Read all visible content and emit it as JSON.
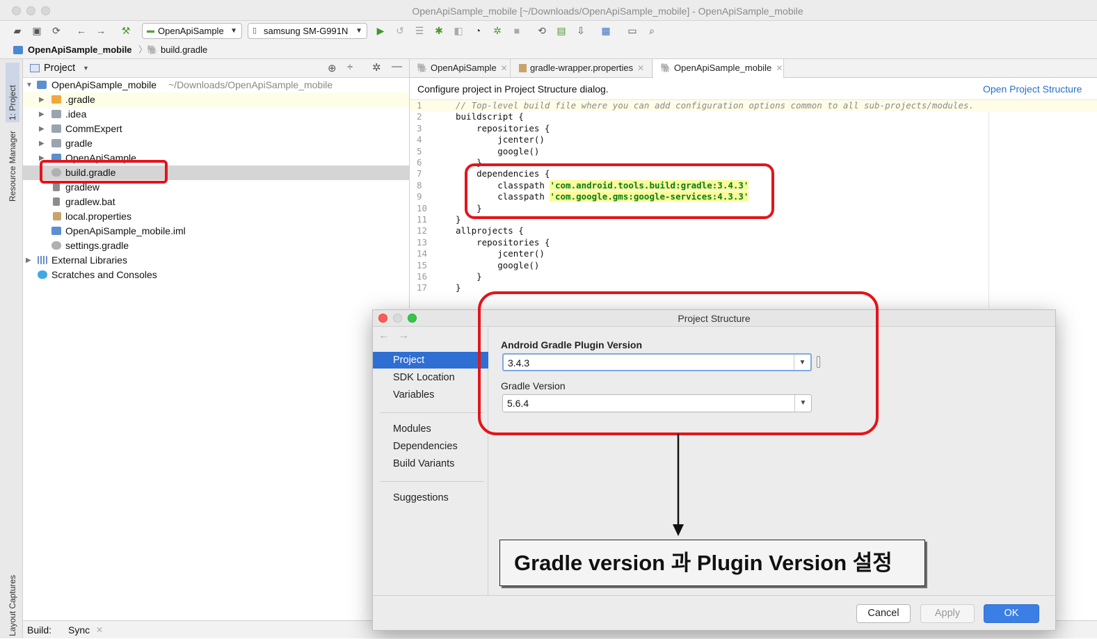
{
  "window": {
    "title": "OpenApiSample_mobile [~/Downloads/OpenApiSample_mobile] - OpenApiSample_mobile"
  },
  "toolbar": {
    "config_combo": "OpenApiSample",
    "device_combo": "samsung SM-G991N"
  },
  "breadcrumb": {
    "project": "OpenApiSample_mobile",
    "file": "build.gradle"
  },
  "side_strip": {
    "project_tab": "1: Project",
    "resource_manager": "Resource Manager",
    "layout_captures": "Layout Captures"
  },
  "project_panel": {
    "header": "Project",
    "tree": [
      {
        "label": "OpenApiSample_mobile",
        "path": "~/Downloads/OpenApiSample_mobile"
      },
      {
        "label": ".gradle"
      },
      {
        "label": ".idea"
      },
      {
        "label": "CommExpert"
      },
      {
        "label": "gradle"
      },
      {
        "label": "OpenApiSample"
      },
      {
        "label": "build.gradle"
      },
      {
        "label": "gradlew"
      },
      {
        "label": "gradlew.bat"
      },
      {
        "label": "local.properties"
      },
      {
        "label": "OpenApiSample_mobile.iml"
      },
      {
        "label": "settings.gradle"
      },
      {
        "label": "External Libraries"
      },
      {
        "label": "Scratches and Consoles"
      }
    ]
  },
  "bottom_bar": {
    "build_label": "Build:",
    "sync_tab": "Sync"
  },
  "editor": {
    "tabs": [
      {
        "label": "OpenApiSample"
      },
      {
        "label": "gradle-wrapper.properties"
      },
      {
        "label": "OpenApiSample_mobile"
      }
    ],
    "notice": "Configure project in Project Structure dialog.",
    "notice_link": "Open Project Structure",
    "lines": [
      "// Top-level build file where you can add configuration options common to all sub-projects/modules.",
      "buildscript {",
      "    repositories {",
      "        jcenter()",
      "        google()",
      "    }",
      "    dependencies {",
      "        classpath ",
      "        classpath ",
      "    }",
      "}",
      "allprojects {",
      "    repositories {",
      "        jcenter()",
      "        google()",
      "    }",
      "}"
    ],
    "strings": {
      "line8": "'com.android.tools.build:gradle:3.4.3'",
      "line9": "'com.google.gms:google-services:4.3.3'"
    },
    "line_numbers": [
      "1",
      "2",
      "3",
      "4",
      "5",
      "6",
      "7",
      "8",
      "9",
      "10",
      "11",
      "12",
      "13",
      "14",
      "15",
      "16",
      "17"
    ]
  },
  "dialog": {
    "title": "Project Structure",
    "nav": {
      "project": "Project",
      "sdk_location": "SDK Location",
      "variables": "Variables",
      "modules": "Modules",
      "dependencies": "Dependencies",
      "build_variants": "Build Variants",
      "suggestions": "Suggestions"
    },
    "agp_label": "Android Gradle Plugin Version",
    "agp_value": "3.4.3",
    "gradle_label": "Gradle Version",
    "gradle_value": "5.6.4",
    "buttons": {
      "cancel": "Cancel",
      "apply": "Apply",
      "ok": "OK"
    }
  },
  "annotation": {
    "text": "Gradle version 과 Plugin Version 설정"
  },
  "colors": {
    "highlight_red": "#e4141b",
    "selection_blue": "#2f6ed3",
    "string_green": "#067d17"
  }
}
